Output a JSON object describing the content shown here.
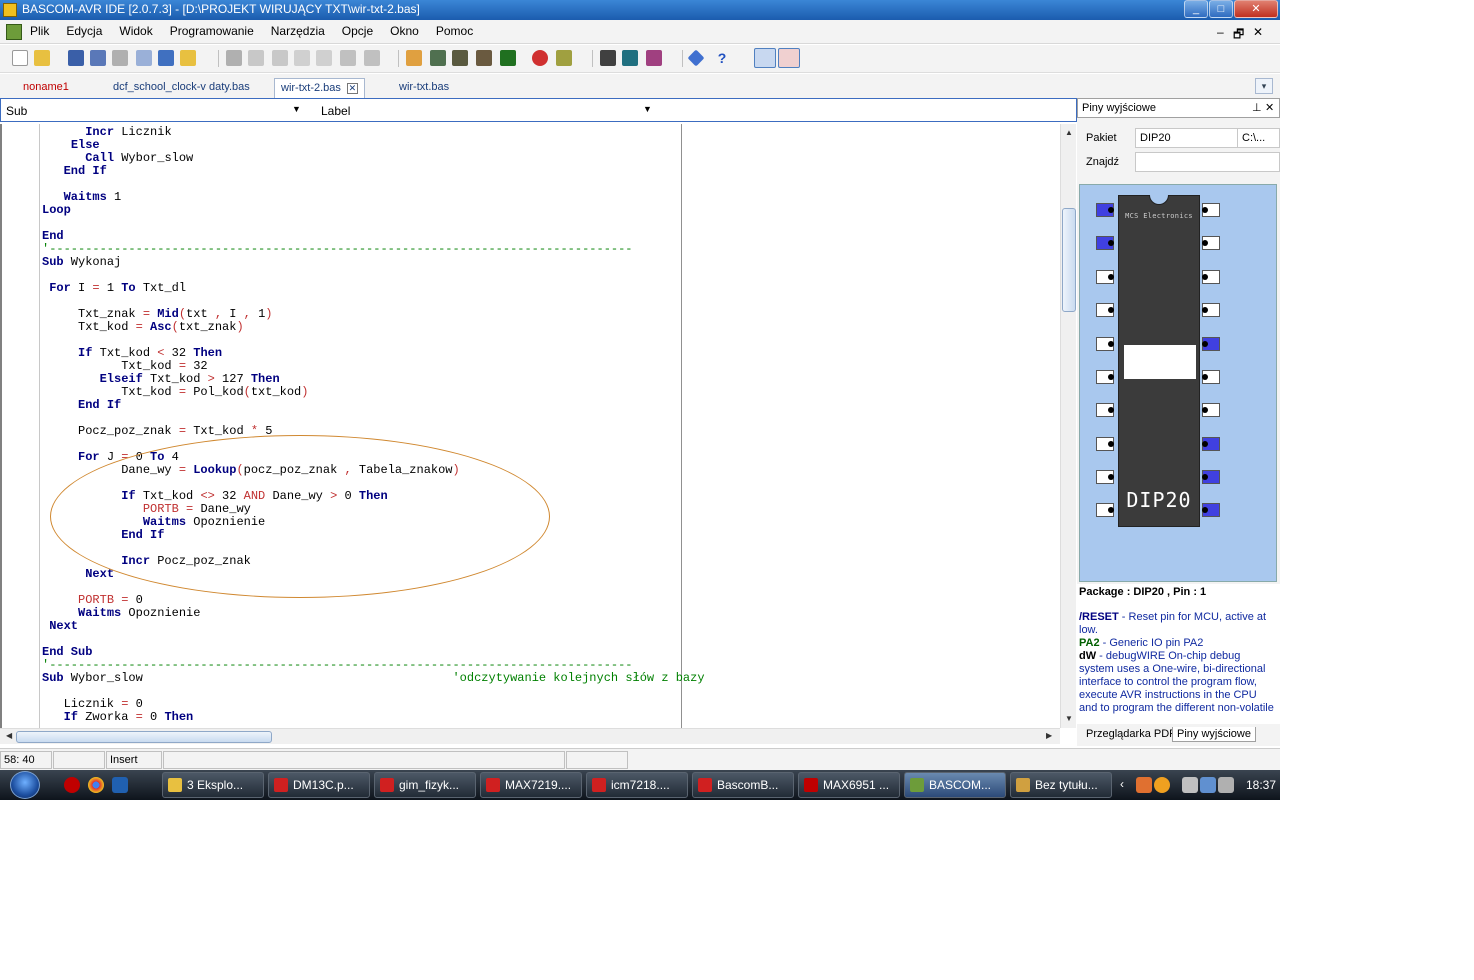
{
  "window": {
    "title": "BASCOM-AVR IDE [2.0.7.3] - [D:\\PROJEKT WIRUJĄCY TXT\\wir-txt-2.bas]",
    "controls": [
      "_",
      "□",
      "✕"
    ]
  },
  "menu": {
    "items": [
      "Plik",
      "Edycja",
      "Widok",
      "Programowanie",
      "Narzędzia",
      "Opcje",
      "Okno",
      "Pomoc"
    ],
    "mdi_controls": [
      "–",
      "🗗",
      "✕"
    ]
  },
  "tabs": [
    {
      "label": "noname1",
      "color": "#c00000",
      "active": false
    },
    {
      "label": "dcf_school_clock-v daty.bas",
      "active": false
    },
    {
      "label": "wir-txt-2.bas",
      "active": true
    },
    {
      "label": "wir-txt.bas",
      "active": false
    }
  ],
  "subbar": {
    "sub_label": "Sub",
    "sub_value": "",
    "label_label": "Label",
    "label_value": ""
  },
  "editor": {
    "lines": [
      [
        [
          "",
          "      "
        ],
        [
          "k",
          "Incr"
        ],
        [
          "",
          " Licznik"
        ]
      ],
      [
        [
          "",
          "    "
        ],
        [
          "k",
          "Else"
        ]
      ],
      [
        [
          "",
          "      "
        ],
        [
          "k",
          "Call"
        ],
        [
          "",
          " Wybor_slow"
        ]
      ],
      [
        [
          "",
          "   "
        ],
        [
          "k",
          "End If"
        ]
      ],
      [
        [
          "",
          ""
        ]
      ],
      [
        [
          "",
          "   "
        ],
        [
          "k",
          "Waitms"
        ],
        [
          "",
          " 1"
        ]
      ],
      [
        [
          "k",
          "Loop"
        ]
      ],
      [
        [
          "",
          ""
        ]
      ],
      [
        [
          "k",
          "End"
        ]
      ],
      [
        [
          "sep",
          "'---------------------------------------------------------------------------------"
        ]
      ],
      [
        [
          "k",
          "Sub"
        ],
        [
          "",
          " Wykonaj"
        ]
      ],
      [
        [
          "",
          ""
        ]
      ],
      [
        [
          "",
          " "
        ],
        [
          "k",
          "For"
        ],
        [
          "",
          " I "
        ],
        [
          "o",
          "="
        ],
        [
          "",
          " 1 "
        ],
        [
          "k",
          "To"
        ],
        [
          "",
          " Txt_dl"
        ]
      ],
      [
        [
          "",
          ""
        ]
      ],
      [
        [
          "",
          "     Txt_znak "
        ],
        [
          "o",
          "="
        ],
        [
          "",
          " "
        ],
        [
          "f",
          "Mid"
        ],
        [
          "o",
          "("
        ],
        [
          "",
          "txt "
        ],
        [
          "o",
          ","
        ],
        [
          "",
          " I "
        ],
        [
          "o",
          ","
        ],
        [
          "",
          " 1"
        ],
        [
          "o",
          ")"
        ]
      ],
      [
        [
          "",
          "     Txt_kod "
        ],
        [
          "o",
          "="
        ],
        [
          "",
          " "
        ],
        [
          "f",
          "Asc"
        ],
        [
          "o",
          "("
        ],
        [
          "",
          "txt_znak"
        ],
        [
          "o",
          ")"
        ]
      ],
      [
        [
          "",
          ""
        ]
      ],
      [
        [
          "",
          "     "
        ],
        [
          "k",
          "If"
        ],
        [
          "",
          " Txt_kod "
        ],
        [
          "o",
          "<"
        ],
        [
          "",
          " 32 "
        ],
        [
          "k",
          "Then"
        ]
      ],
      [
        [
          "",
          "           Txt_kod "
        ],
        [
          "o",
          "="
        ],
        [
          "",
          " 32"
        ]
      ],
      [
        [
          "",
          "        "
        ],
        [
          "k",
          "Elseif"
        ],
        [
          "",
          " Txt_kod "
        ],
        [
          "o",
          ">"
        ],
        [
          "",
          " 127 "
        ],
        [
          "k",
          "Then"
        ]
      ],
      [
        [
          "",
          "           Txt_kod "
        ],
        [
          "o",
          "="
        ],
        [
          "",
          " Pol_kod"
        ],
        [
          "o",
          "("
        ],
        [
          "",
          "txt_kod"
        ],
        [
          "o",
          ")"
        ]
      ],
      [
        [
          "",
          "     "
        ],
        [
          "k",
          "End If"
        ]
      ],
      [
        [
          "",
          ""
        ]
      ],
      [
        [
          "",
          "     Pocz_poz_znak "
        ],
        [
          "o",
          "="
        ],
        [
          "",
          " Txt_kod "
        ],
        [
          "o",
          "*"
        ],
        [
          "",
          " 5"
        ]
      ],
      [
        [
          "",
          ""
        ]
      ],
      [
        [
          "",
          "     "
        ],
        [
          "k",
          "For"
        ],
        [
          "",
          " J "
        ],
        [
          "o",
          "="
        ],
        [
          "",
          " 0 "
        ],
        [
          "k",
          "To"
        ],
        [
          "",
          " 4"
        ]
      ],
      [
        [
          "",
          "           Dane_wy "
        ],
        [
          "o",
          "="
        ],
        [
          "",
          " "
        ],
        [
          "f",
          "Lookup"
        ],
        [
          "o",
          "("
        ],
        [
          "",
          "pocz_poz_znak "
        ],
        [
          "o",
          ","
        ],
        [
          "",
          " Tabela_znakow"
        ],
        [
          "o",
          ")"
        ]
      ],
      [
        [
          "",
          ""
        ]
      ],
      [
        [
          "",
          "           "
        ],
        [
          "k",
          "If"
        ],
        [
          "",
          " Txt_kod "
        ],
        [
          "o",
          "<>"
        ],
        [
          "",
          " 32 "
        ],
        [
          "o",
          "AND"
        ],
        [
          "",
          " Dane_wy "
        ],
        [
          "o",
          ">"
        ],
        [
          "",
          " 0 "
        ],
        [
          "k",
          "Then"
        ]
      ],
      [
        [
          "",
          "              "
        ],
        [
          "o",
          "PORTB"
        ],
        [
          "",
          " "
        ],
        [
          "o",
          "="
        ],
        [
          "",
          " Dane_wy"
        ]
      ],
      [
        [
          "",
          "              "
        ],
        [
          "k",
          "Waitms"
        ],
        [
          "",
          " Opoznienie"
        ]
      ],
      [
        [
          "",
          "           "
        ],
        [
          "k",
          "End If"
        ]
      ],
      [
        [
          "",
          ""
        ]
      ],
      [
        [
          "",
          "           "
        ],
        [
          "k",
          "Incr"
        ],
        [
          "",
          " Pocz_poz_znak"
        ]
      ],
      [
        [
          "",
          "      "
        ],
        [
          "k",
          "Next"
        ]
      ],
      [
        [
          "",
          ""
        ]
      ],
      [
        [
          "",
          "     "
        ],
        [
          "o",
          "PORTB"
        ],
        [
          "",
          " "
        ],
        [
          "o",
          "="
        ],
        [
          "",
          " 0"
        ]
      ],
      [
        [
          "",
          "     "
        ],
        [
          "k",
          "Waitms"
        ],
        [
          "",
          " Opoznienie"
        ]
      ],
      [
        [
          "",
          " "
        ],
        [
          "k",
          "Next"
        ]
      ],
      [
        [
          "",
          ""
        ]
      ],
      [
        [
          "k",
          "End Sub"
        ]
      ],
      [
        [
          "sep",
          "'---------------------------------------------------------------------------------"
        ]
      ],
      [
        [
          "k",
          "Sub"
        ],
        [
          "",
          " Wybor_slow                                           "
        ],
        [
          "c",
          "'odczytywanie kolejnych słów z bazy"
        ]
      ],
      [
        [
          "",
          ""
        ]
      ],
      [
        [
          "",
          "   Licznik "
        ],
        [
          "o",
          "="
        ],
        [
          "",
          " 0"
        ]
      ],
      [
        [
          "",
          "   "
        ],
        [
          "k",
          "If"
        ],
        [
          "",
          " Zworka "
        ],
        [
          "o",
          "="
        ],
        [
          "",
          " 0 "
        ],
        [
          "k",
          "Then"
        ]
      ]
    ]
  },
  "panel": {
    "title": "Piny wyjściowe",
    "pakiet_label": "Pakiet",
    "pakiet_value": "DIP20",
    "pakiet_value2": "C:\\...",
    "znajdz_label": "Znajdź",
    "znajdz_value": "",
    "chip_brand": "MCS Electronics",
    "chip_package": "DIP20",
    "left_pins_active": [
      true,
      true,
      false,
      false,
      false,
      false,
      false,
      false,
      false,
      false
    ],
    "right_pins_active": [
      false,
      false,
      false,
      false,
      true,
      false,
      false,
      true,
      true,
      true
    ],
    "info_header": "Package : DIP20 , Pin : 1",
    "info": [
      {
        "name": "/RESET",
        "text": " - Reset pin for MCU, active at low.",
        "color": "blue"
      },
      {
        "name": "PA2",
        "text": " - Generic IO pin PA2",
        "color": "green"
      },
      {
        "name": "dW",
        "text": " - debugWIRE On-chip debug system uses a One-wire, bi-directional interface to control the program flow, execute AVR instructions in the CPU and to program the different non-volatile",
        "color": "black"
      }
    ],
    "tabs": [
      "Przeglądarka PDF",
      "Piny wyjściowe"
    ]
  },
  "status": {
    "position": "58: 40",
    "cell2": "",
    "mode": "Insert",
    "cell4": "",
    "cell5": ""
  },
  "taskbar": {
    "tasks": [
      {
        "label": "3 Eksplo...",
        "color": "#e8c040"
      },
      {
        "label": "DM13C.p...",
        "color": "#d02020"
      },
      {
        "label": "gim_fizyk...",
        "color": "#d02020"
      },
      {
        "label": "MAX7219....",
        "color": "#d02020"
      },
      {
        "label": "icm7218....",
        "color": "#d02020"
      },
      {
        "label": "BascomB...",
        "color": "#d02020"
      },
      {
        "label": "MAX6951 ...",
        "color": "#c00000"
      },
      {
        "label": "BASCOM...",
        "color": "#6d9c3a"
      },
      {
        "label": "Bez tytułu...",
        "color": "#d0a040"
      }
    ],
    "clock": "18:37"
  }
}
